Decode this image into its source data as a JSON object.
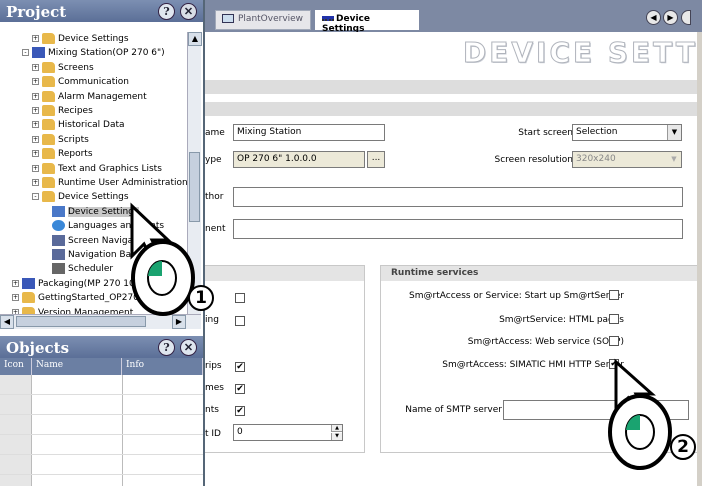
{
  "project_panel": {
    "title": "Project",
    "tree": [
      {
        "label": "Device Settings",
        "indent": 2,
        "pm": "+",
        "icon": "folder"
      },
      {
        "label": "Mixing Station(OP 270 6\")",
        "indent": 1,
        "pm": "-",
        "icon": "device"
      },
      {
        "label": "Screens",
        "indent": 2,
        "pm": "+",
        "icon": "folder"
      },
      {
        "label": "Communication",
        "indent": 2,
        "pm": "+",
        "icon": "folder"
      },
      {
        "label": "Alarm Management",
        "indent": 2,
        "pm": "+",
        "icon": "folder"
      },
      {
        "label": "Recipes",
        "indent": 2,
        "pm": "+",
        "icon": "folder"
      },
      {
        "label": "Historical Data",
        "indent": 2,
        "pm": "+",
        "icon": "folder"
      },
      {
        "label": "Scripts",
        "indent": 2,
        "pm": "+",
        "icon": "folder"
      },
      {
        "label": "Reports",
        "indent": 2,
        "pm": "+",
        "icon": "folder"
      },
      {
        "label": "Text and Graphics Lists",
        "indent": 2,
        "pm": "+",
        "icon": "folder"
      },
      {
        "label": "Runtime User Administration",
        "indent": 2,
        "pm": "+",
        "icon": "folder"
      },
      {
        "label": "Device Settings",
        "indent": 2,
        "pm": "-",
        "icon": "folder"
      },
      {
        "label": "Device Settings",
        "indent": 3,
        "pm": "",
        "icon": "doc",
        "selected": true
      },
      {
        "label": "Languages and Fonts",
        "indent": 3,
        "pm": "",
        "icon": "globe"
      },
      {
        "label": "Screen Navigation",
        "indent": 3,
        "pm": "",
        "icon": "nav"
      },
      {
        "label": "Navigation Bar",
        "indent": 3,
        "pm": "",
        "icon": "nav"
      },
      {
        "label": "Scheduler",
        "indent": 3,
        "pm": "",
        "icon": "sched"
      },
      {
        "label": "Packaging(MP 270 10\")",
        "indent": 0,
        "pm": "+",
        "icon": "device"
      },
      {
        "label": "GettingStarted_OP270",
        "indent": 0,
        "pm": "+",
        "icon": "folder"
      },
      {
        "label": "Version Management",
        "indent": 0,
        "pm": "+",
        "icon": "folder"
      }
    ]
  },
  "objects_panel": {
    "title": "Objects",
    "columns": [
      "Icon",
      "Name",
      "Info"
    ]
  },
  "tabs": [
    {
      "label": "PlantOverview",
      "active": false
    },
    {
      "label": "Device Settings",
      "active": true
    }
  ],
  "page_title": "DEVICE SETT",
  "form": {
    "name_label": "ame",
    "name_value": "Mixing Station",
    "type_label": "ype",
    "type_value": "OP 270 6\" 1.0.0.0",
    "type_btn": "...",
    "author_label": "thor",
    "comment_label": "nent",
    "start_screen_label": "Start screen",
    "start_screen_value": "Selection",
    "screen_res_label": "Screen resolution",
    "screen_res_value": "320x240"
  },
  "left_checks": [
    {
      "label": "d",
      "checked": false
    },
    {
      "label": "ing",
      "checked": false
    },
    {
      "label": "rips",
      "checked": true
    },
    {
      "label": "mes",
      "checked": true
    },
    {
      "label": "nts",
      "checked": true
    }
  ],
  "id_label": "t ID",
  "id_value": "0",
  "runtime_services": {
    "title": "Runtime services",
    "items": [
      {
        "label": "Sm@rtAccess or Service: Start up Sm@rtServer",
        "checked": false
      },
      {
        "label": "Sm@rtService: HTML pages",
        "checked": false
      },
      {
        "label": "Sm@rtAccess: Web service (SOAP)",
        "checked": false
      },
      {
        "label": "Sm@rtAccess: SIMATIC HMI HTTP Server",
        "checked": true
      }
    ],
    "smtp_label": "Name of SMTP server",
    "smtp_value": ""
  },
  "badges": [
    "1",
    "2"
  ],
  "colors": {
    "panel_title": "#6b7fa3",
    "tabbar": "#7d89a3"
  }
}
